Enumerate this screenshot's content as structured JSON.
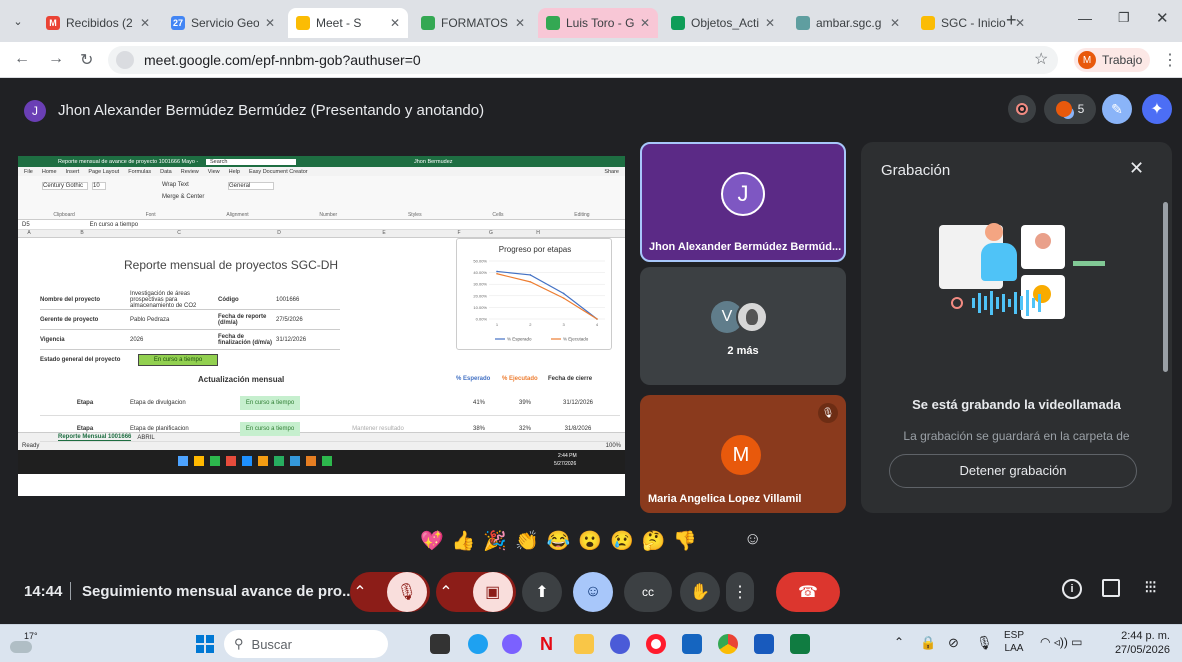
{
  "browser": {
    "tabs": [
      {
        "label": "Recibidos (2",
        "color": "#ea4335",
        "glyph": "M",
        "state": "normal"
      },
      {
        "label": "Servicio Geo",
        "color": "#4285f4",
        "glyph": "27",
        "state": "normal"
      },
      {
        "label": "Meet - S",
        "color": "#fbbc04",
        "glyph": "",
        "state": "active"
      },
      {
        "label": "FORMATOS",
        "color": "#34a853",
        "glyph": "",
        "state": "normal"
      },
      {
        "label": "Luis Toro - G",
        "color": "#34a853",
        "glyph": "",
        "state": "pink"
      },
      {
        "label": "Objetos_Acti",
        "color": "#0f9d58",
        "glyph": "",
        "state": "normal"
      },
      {
        "label": "ambar.sgc.g",
        "color": "#5f9ea0",
        "glyph": "",
        "state": "normal"
      },
      {
        "label": "SGC - Inicio",
        "color": "#fbbc04",
        "glyph": "",
        "state": "normal"
      }
    ],
    "url": "meet.google.com/epf-nnbm-gob?authuser=0",
    "profile_initial": "M",
    "profile_label": "Trabajo"
  },
  "meet": {
    "presenter_initial": "J",
    "presenter_title": "Jhon Alexander Bermúdez Bermúdez (Presentando y anotando)",
    "participant_count": "5",
    "tiles": {
      "jhon_name": "Jhon Alexander Bermúdez Bermúd...",
      "jhon_initial": "J",
      "more_label": "2 más",
      "more_initial": "V",
      "maria_name": "Maria Angelica Lopez Villamil",
      "maria_initial": "M"
    },
    "recording_panel": {
      "title": "Grabación",
      "headline": "Se está grabando la videollamada",
      "description": "La grabación se guardará en la carpeta de",
      "stop_label": "Detener grabación"
    },
    "reactions": [
      "💖",
      "👍",
      "🎉",
      "👏",
      "😂",
      "😮",
      "😢",
      "🤔",
      "👎"
    ],
    "time": "14:44",
    "meeting_title": "Seguimiento mensual avance de pro..."
  },
  "excel": {
    "title_bar": "Reporte mensual de avance de proyecto 1001666 Mayo - Excel",
    "search": "Search",
    "user": "Jhon Bermudez",
    "menu": [
      "File",
      "Home",
      "Insert",
      "Page Layout",
      "Formulas",
      "Data",
      "Review",
      "View",
      "Help",
      "Easy Document Creator"
    ],
    "share": "Share",
    "ribbon": {
      "font": "Century Gothic",
      "font_size": "10",
      "wrap": "Wrap Text",
      "merge": "Merge & Center",
      "number_format": "General",
      "groups": [
        "Clipboard",
        "Font",
        "Alignment",
        "Number",
        "Styles",
        "Cells",
        "Editing"
      ]
    },
    "cell_ref": "D5",
    "formula": "En curso a tiempo",
    "columns": [
      "A",
      "B",
      "C",
      "D",
      "E",
      "F",
      "G",
      "H"
    ],
    "report_title": "Reporte mensual de proyectos SGC-DH",
    "fields": [
      {
        "label": "Nombre del proyecto",
        "value": "Investigación de áreas prospectivas para almacenamiento de CO2",
        "label2": "Código",
        "value2": "1001666"
      },
      {
        "label": "Gerente de proyecto",
        "value": "Pablo Pedraza",
        "label2": "Fecha de reporte (d/m/a)",
        "value2": "27/5/2026"
      },
      {
        "label": "Vigencia",
        "value": "2026",
        "label2": "Fecha de finalización (d/m/a)",
        "value2": "31/12/2026"
      }
    ],
    "status_label": "Estado general del proyecto",
    "status_value": "En curso a tiempo",
    "section_title": "Actualización mensual",
    "table_headers": [
      "% Esperado",
      "% Ejecutado",
      "Fecha de cierre"
    ],
    "rows": [
      {
        "stage": "Etapa",
        "name": "Etapa de divulgacion",
        "status": "En curso a tiempo",
        "expected": "41%",
        "executed": "39%",
        "close": "31/12/2026"
      },
      {
        "stage": "Etapa",
        "name": "Etapa de planificacion",
        "status": "En curso a tiempo",
        "note": "Mantener resultado",
        "expected": "38%",
        "executed": "32%",
        "close": "31/8/2026"
      }
    ],
    "sheet_tabs": [
      "Reporte Mensual 1001666",
      "ABRIL"
    ],
    "status_ready": "Ready",
    "zoom": "100%",
    "taskbar_time": "2:44 PM",
    "taskbar_date": "5/27/2026"
  },
  "chart_data": {
    "type": "line",
    "title": "Progreso por etapas",
    "categories": [
      "1",
      "2",
      "3",
      "4"
    ],
    "series": [
      {
        "name": "% Esperado",
        "values": [
          0.41,
          0.38,
          0.22,
          0.0
        ],
        "color": "#4472c4"
      },
      {
        "name": "% Ejecutado",
        "values": [
          0.39,
          0.32,
          0.18,
          0.0
        ],
        "color": "#ed7d31"
      }
    ],
    "yticks": [
      "0.00%",
      "10.00%",
      "20.00%",
      "30.00%",
      "40.00%",
      "50.00%"
    ],
    "ylim": [
      0,
      0.5
    ],
    "legend": "bottom"
  },
  "taskbar": {
    "weather": "17°",
    "search": "Buscar",
    "lang": "ESP",
    "lang2": "LAA",
    "time": "2:44 p. m.",
    "date": "27/05/2026"
  }
}
